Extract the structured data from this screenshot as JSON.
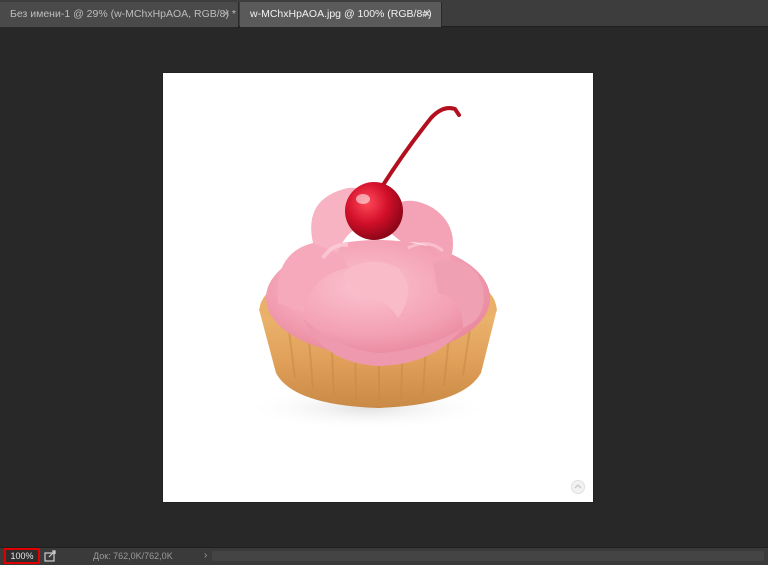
{
  "tabs": [
    {
      "label": "Без имени-1 @ 29% (w-MChxHpAOA, RGB/8) *",
      "close_glyph": "✕",
      "active": false
    },
    {
      "label": "w-MChxHpAOA.jpg @ 100% (RGB/8#)",
      "close_glyph": "✕",
      "active": true
    }
  ],
  "document": {
    "image_subject": "cupcake-with-cherry",
    "corner_icon": "watermark-icon"
  },
  "statusbar": {
    "zoom": "100%",
    "export_icon": "export-icon",
    "doc_info": "Док: 762,0K/762,0K",
    "arrow": "›"
  },
  "colors": {
    "workspace": "#282828",
    "tab_active": "#5a5a5a",
    "tab_inactive": "#4a4a4a",
    "highlight": "#e00000",
    "cream": "#f5a3b6",
    "cherry": "#d0122a",
    "tart": "#e0a45a"
  }
}
